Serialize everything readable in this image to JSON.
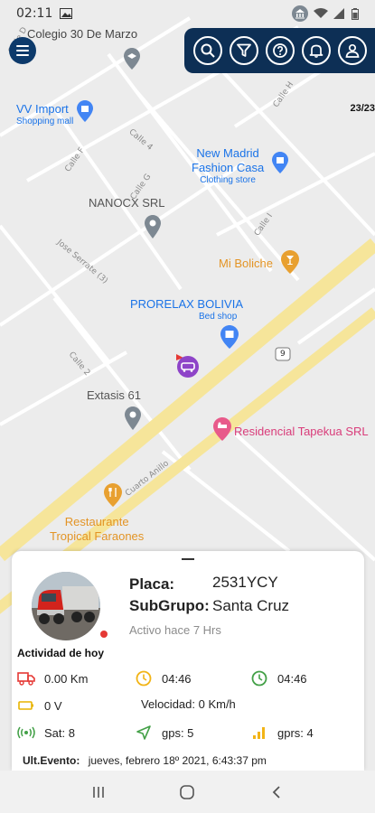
{
  "status_bar": {
    "time": "02:11"
  },
  "map": {
    "streets": {
      "calle_d": "Calle D",
      "calle_h": "Calle H",
      "calle_4": "Calle 4",
      "calle_f": "Calle F",
      "calle_g": "Calle G",
      "calle_i": "Calle I",
      "jose_serrate": "Jose Serrate (3)",
      "calle_2": "Calle 2",
      "cuarto_anillo": "Cuarto Anillo",
      "route_shield": "9"
    },
    "pois": {
      "colegio": "Colegio 30 De Marzo",
      "vv_import": "VV Import",
      "vv_import_sub": "Shopping mall",
      "new_madrid_1": "New Madrid",
      "new_madrid_2": "Fashion Casa",
      "new_madrid_sub": "Clothing store",
      "nanocx": "NANOCX SRL",
      "mi_boliche": "Mi Boliche",
      "prorelax": "PRORELAX BOLIVIA",
      "prorelax_sub": "Bed shop",
      "extasis": "Extasis 61",
      "tapekua": "Residencial Tapekua SRL",
      "restaurante_1": "Restaurante",
      "restaurante_2": "Tropical Faraones"
    },
    "counter": "23/23"
  },
  "toolbar": {
    "search_icon": "search-icon",
    "filter_icon": "filter-icon",
    "help_icon": "help-icon",
    "bell_icon": "bell-icon",
    "user_icon": "user-icon"
  },
  "vehicle_card": {
    "placa_label": "Placa:",
    "placa_value": "2531YCY",
    "subgrupo_label": "SubGrupo:",
    "subgrupo_value": "Santa Cruz",
    "active_ago": "Activo hace 7 Hrs",
    "activity_title": "Actividad de hoy",
    "distance": "0.00 Km",
    "time_stopped": "04:46",
    "time_running": "04:46",
    "voltage": "0 V",
    "speed": "Velocidad: 0 Km/h",
    "satellites": "Sat: 8",
    "gps": "gps: 5",
    "gprs": "gprs: 4",
    "last_event_label": "Ult.Evento:",
    "last_event_value": "jueves, febrero 18º 2021, 6:43:37 pm"
  },
  "colors": {
    "primary": "#0d2f55",
    "road": "#f7e8a0",
    "poi_blue": "#1a73e8",
    "poi_orange": "#e8a030",
    "poi_pink": "#d93c7a",
    "truck_red": "#e53935",
    "clock_yellow": "#f2b416",
    "clock_green": "#43a047"
  }
}
